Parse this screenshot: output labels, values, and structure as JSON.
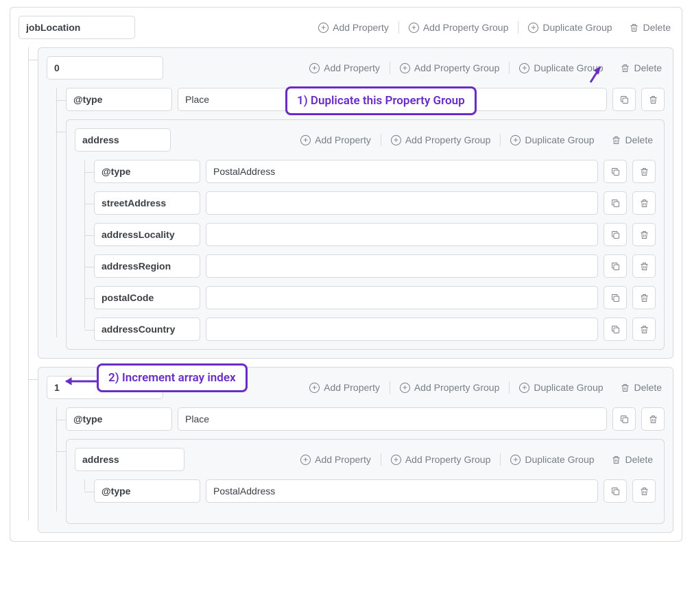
{
  "labels": {
    "add_property": "Add Property",
    "add_property_group": "Add Property Group",
    "duplicate_group": "Duplicate Group",
    "delete": "Delete"
  },
  "annotations": {
    "callout1": "1) Duplicate this Property Group",
    "callout2": "2) Increment array index"
  },
  "root": {
    "name": "jobLocation",
    "items": [
      {
        "name": "0",
        "type": {
          "key": "@type",
          "value": "Place"
        },
        "address": {
          "name": "address",
          "props": [
            {
              "key": "@type",
              "value": "PostalAddress"
            },
            {
              "key": "streetAddress",
              "value": ""
            },
            {
              "key": "addressLocality",
              "value": ""
            },
            {
              "key": "addressRegion",
              "value": ""
            },
            {
              "key": "postalCode",
              "value": ""
            },
            {
              "key": "addressCountry",
              "value": ""
            }
          ]
        }
      },
      {
        "name": "1",
        "type": {
          "key": "@type",
          "value": "Place"
        },
        "address": {
          "name": "address",
          "props": [
            {
              "key": "@type",
              "value": "PostalAddress"
            }
          ]
        }
      }
    ]
  }
}
